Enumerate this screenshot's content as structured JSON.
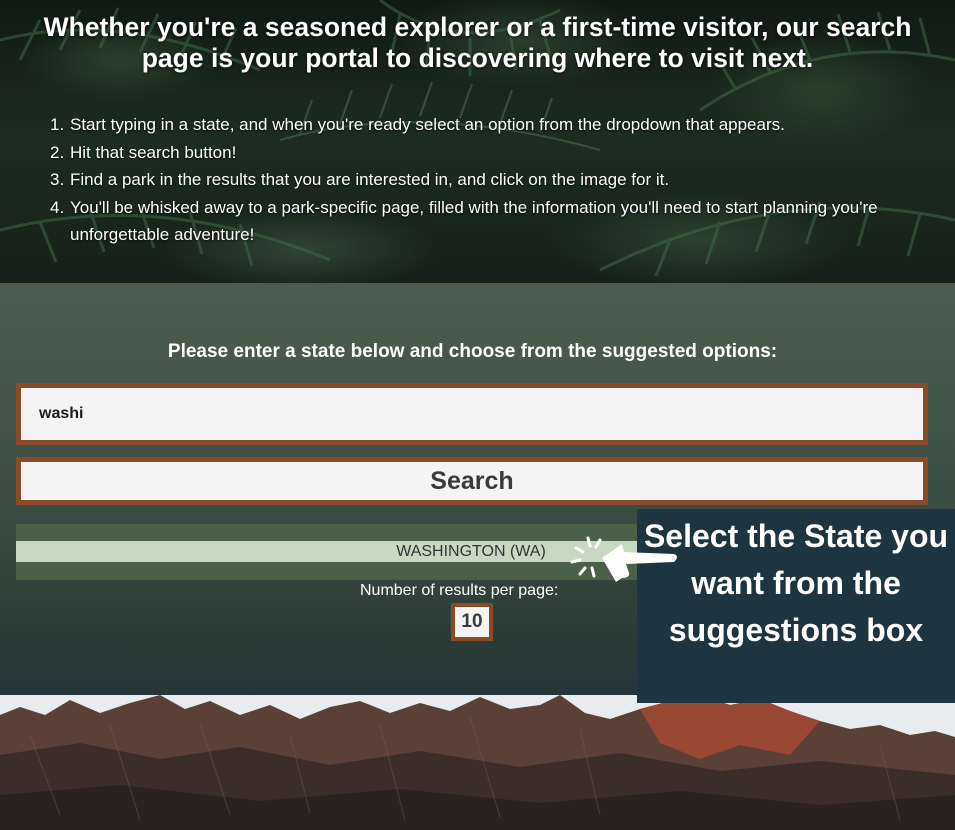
{
  "hero": {
    "title": "Whether you're a seasoned explorer or a first-time visitor, our search page is your portal to discovering where to visit next.",
    "steps": [
      {
        "num": "1.",
        "text": "Start typing in a state, and when you're ready select an option from the dropdown that appears."
      },
      {
        "num": "2.",
        "text": "Hit that search button!"
      },
      {
        "num": "3.",
        "text": "Find a park in the results that you are interested in, and click on the image for it."
      },
      {
        "num": "4.",
        "text": "You'll be whisked away to a park-specific page, filled with the information you'll need to start planning you're unforgettable adventure!"
      }
    ]
  },
  "search": {
    "prompt": "Please enter a state below and choose from the suggested options:",
    "input_value": "washi",
    "button_label": "Search",
    "suggestion": "WASHINGTON (WA)",
    "results_per_page_label": "Number of results per page:",
    "results_per_page_value": "10"
  },
  "callout": {
    "text": "Select the State you want from the suggestions box",
    "icon": "pointer-hand-icon"
  },
  "colors": {
    "input_border": "#8b4a28",
    "suggestion_bg": "#c8d9c2",
    "suggest_box_bg": "#4a6048",
    "callout_bg": "#1f3441"
  }
}
